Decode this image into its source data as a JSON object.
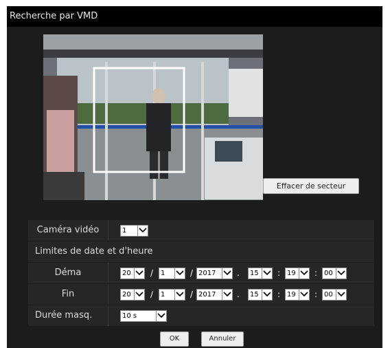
{
  "window": {
    "title": "Recherche par VMD"
  },
  "preview": {
    "clear_area_label": "Effacer de secteur"
  },
  "form": {
    "camera_label": "Caméra vidéo",
    "camera_value": "1",
    "date_limits_label": "Limites de date et d'heure",
    "start": {
      "label": "Déma",
      "day": "20",
      "month": "1",
      "year": "2017",
      "hour": "15",
      "minute": "19",
      "second": "00"
    },
    "end": {
      "label": "Fin",
      "day": "20",
      "month": "1",
      "year": "2017",
      "hour": "15",
      "minute": "19",
      "second": "00"
    },
    "duration_label": "Durée masq.",
    "duration_value": "10 s",
    "sep_slash": "/",
    "sep_dot": ".",
    "sep_colon": ":"
  },
  "buttons": {
    "ok": "OK",
    "cancel": "Annuler"
  },
  "icons": {
    "dropdown": "chevron-down-icon"
  }
}
